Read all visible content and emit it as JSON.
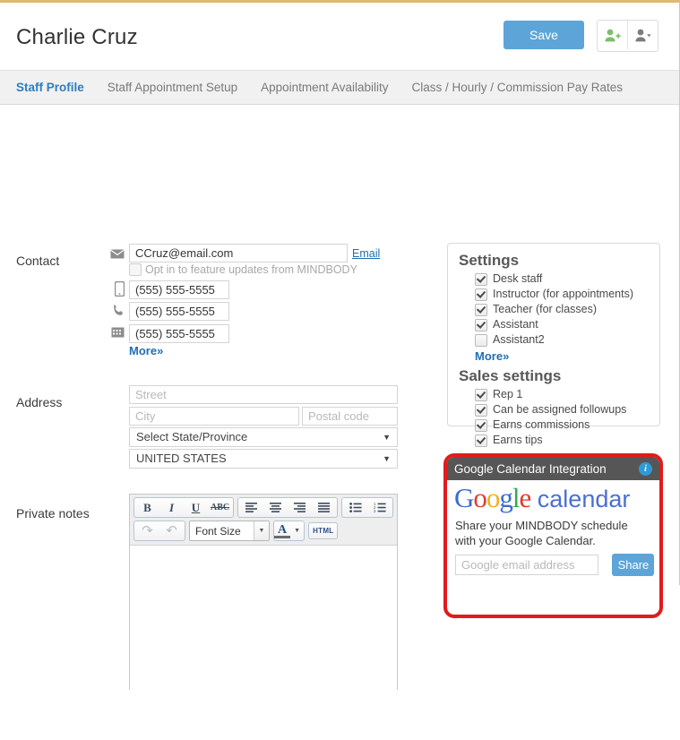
{
  "header": {
    "title": "Charlie Cruz",
    "save_label": "Save",
    "add_user_icon": "user-plus-icon",
    "user_menu_icon": "user-dropdown-icon"
  },
  "tabs": [
    {
      "label": "Staff Profile",
      "active": true
    },
    {
      "label": "Staff Appointment Setup",
      "active": false
    },
    {
      "label": "Appointment Availability",
      "active": false
    },
    {
      "label": "Class / Hourly / Commission Pay Rates",
      "active": false
    }
  ],
  "contact": {
    "label": "Contact",
    "email_value": "CCruz@email.com",
    "email_link": "Email",
    "optin_label": "Opt in to feature updates from MINDBODY",
    "optin_checked": false,
    "mobile_value": "(555) 555-5555",
    "phone_value": "(555) 555-5555",
    "fax_value": "(555) 555-5555",
    "more_label": "More",
    "more_chevron": "»"
  },
  "address": {
    "label": "Address",
    "street_placeholder": "Street",
    "city_placeholder": "City",
    "postal_placeholder": "Postal code",
    "state_value": "Select State/Province",
    "country_value": "UNITED STATES",
    "caret": "▼"
  },
  "private_notes": {
    "label": "Private notes",
    "toolbar": {
      "bold": "B",
      "italic": "I",
      "underline": "U",
      "strikethrough": "ABC",
      "align_left": "align-left-icon",
      "align_center": "align-center-icon",
      "align_right": "align-right-icon",
      "align_justify": "align-justify-icon",
      "bullet_list": "bullet-list-icon",
      "numbered_list": "numbered-list-icon",
      "redo": "↷",
      "undo": "↶",
      "font_size": "Font Size",
      "font_color": "A",
      "html": "HTML",
      "dropdown_caret": "▼"
    },
    "body_value": ""
  },
  "settings_card": {
    "title": "Settings",
    "items": [
      {
        "label": "Desk staff",
        "checked": true
      },
      {
        "label": "Instructor (for appointments)",
        "checked": true
      },
      {
        "label": "Teacher (for classes)",
        "checked": true
      },
      {
        "label": "Assistant",
        "checked": true
      },
      {
        "label": "Assistant2",
        "checked": false
      }
    ],
    "more_label": "More",
    "more_chevron": "»",
    "sales_title": "Sales settings",
    "sales_items": [
      {
        "label": "Rep 1",
        "checked": true
      },
      {
        "label": "Can be assigned followups",
        "checked": true
      },
      {
        "label": "Earns commissions",
        "checked": true
      },
      {
        "label": "Earns tips",
        "checked": true
      }
    ]
  },
  "google_card": {
    "header_title": "Google Calendar Integration",
    "info_icon": "info-icon",
    "info_glyph": "i",
    "logo_g": "G",
    "logo_o1": "o",
    "logo_o2": "o",
    "logo_g2": "g",
    "logo_l": "l",
    "logo_e": "e",
    "logo_calendar": "calendar",
    "description": "Share your MINDBODY schedule with your Google Calendar.",
    "email_placeholder": "Google email address",
    "email_value": "",
    "share_label": "Share",
    "highlight_color": "#e21b1b"
  },
  "colors": {
    "accent_blue": "#5da5d8",
    "link_blue": "#1f6fb5",
    "tab_active": "#2a7fc1",
    "top_border": "#e0b873",
    "google_blue": "#3a6cd4",
    "google_red": "#e03b2f",
    "google_yellow": "#efb01d",
    "google_green": "#36a84f"
  }
}
